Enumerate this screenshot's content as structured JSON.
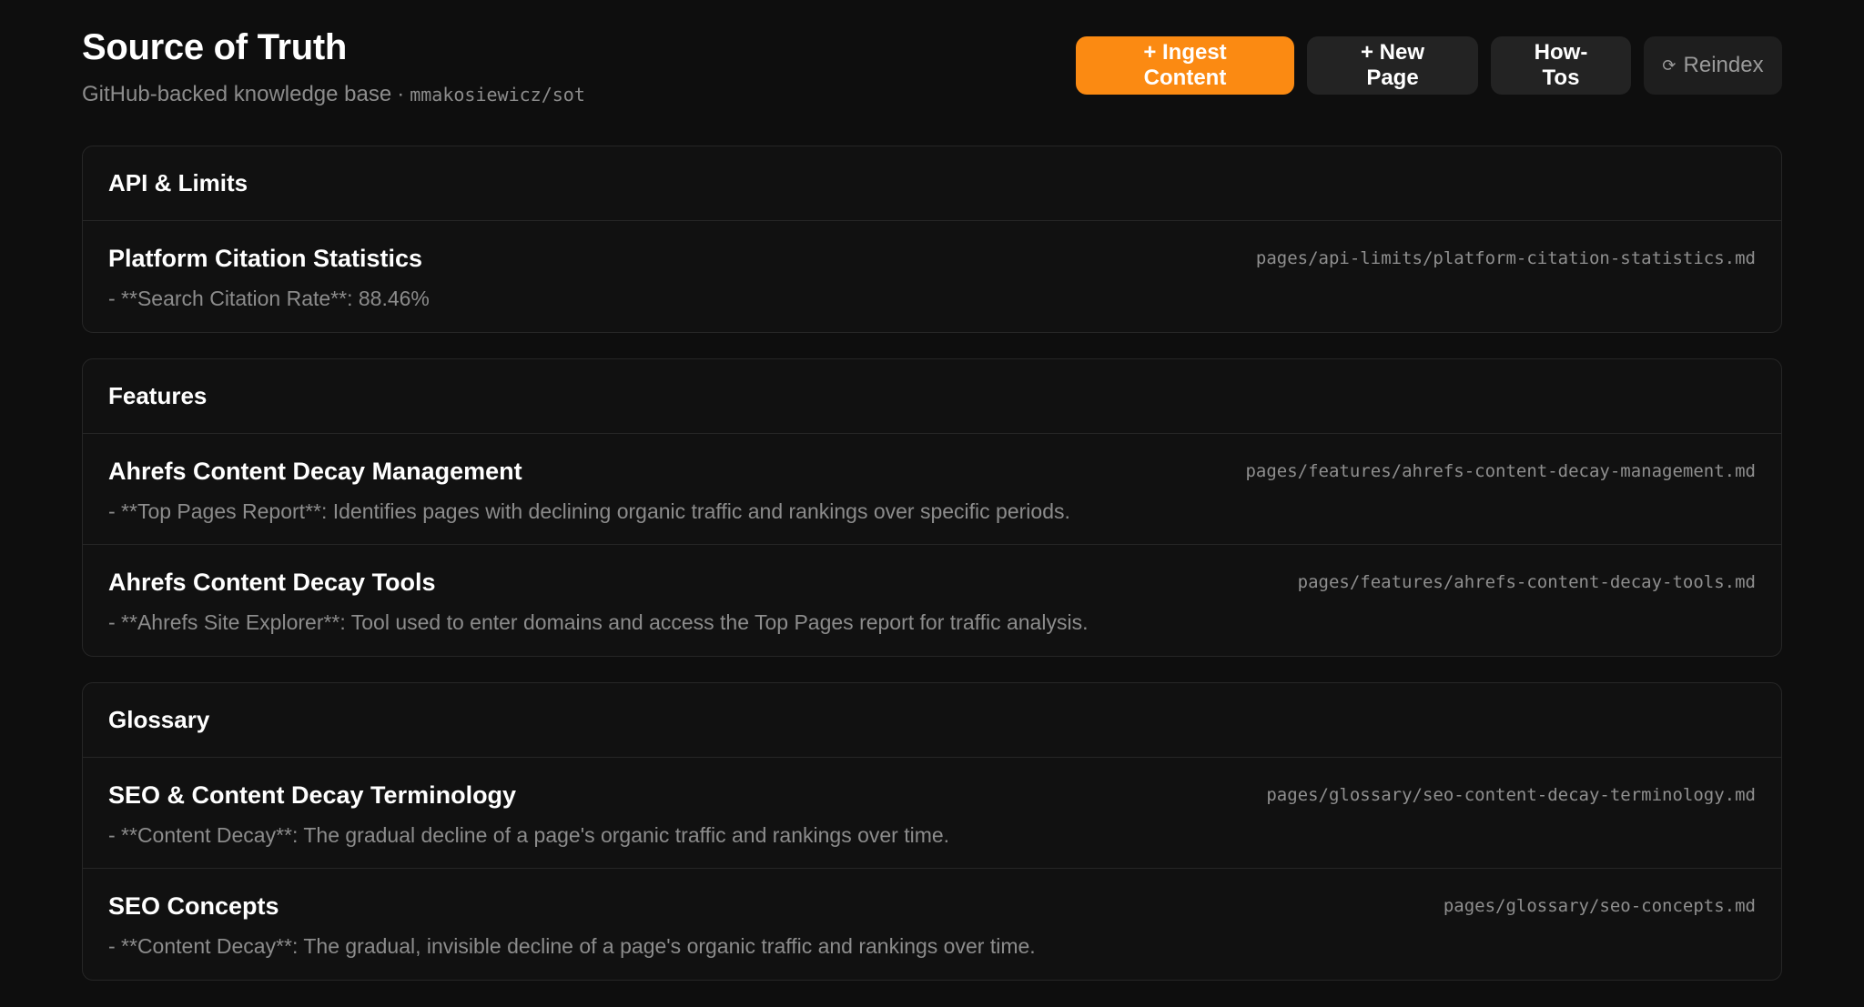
{
  "header": {
    "title": "Source of Truth",
    "subtitle": "GitHub-backed knowledge base",
    "separator": "·",
    "repo": "mmakosiewicz/sot"
  },
  "actions": {
    "ingest_label": "+ Ingest Content",
    "new_page_label": "+ New Page",
    "howtos_label": "How-Tos",
    "reindex_icon": "⟳",
    "reindex_label": "Reindex"
  },
  "colors": {
    "accent": "#fb8a12",
    "background": "#0e0e0e"
  },
  "sections": [
    {
      "name": "API & Limits",
      "entries": [
        {
          "title": "Platform Citation Statistics",
          "path": "pages/api-limits/platform-citation-statistics.md",
          "desc": "- **Search Citation Rate**: 88.46%"
        }
      ]
    },
    {
      "name": "Features",
      "entries": [
        {
          "title": "Ahrefs Content Decay Management",
          "path": "pages/features/ahrefs-content-decay-management.md",
          "desc": "- **Top Pages Report**: Identifies pages with declining organic traffic and rankings over specific periods."
        },
        {
          "title": "Ahrefs Content Decay Tools",
          "path": "pages/features/ahrefs-content-decay-tools.md",
          "desc": "- **Ahrefs Site Explorer**: Tool used to enter domains and access the Top Pages report for traffic analysis."
        }
      ]
    },
    {
      "name": "Glossary",
      "entries": [
        {
          "title": "SEO & Content Decay Terminology",
          "path": "pages/glossary/seo-content-decay-terminology.md",
          "desc": "- **Content Decay**: The gradual decline of a page's organic traffic and rankings over time."
        },
        {
          "title": "SEO Concepts",
          "path": "pages/glossary/seo-concepts.md",
          "desc": "- **Content Decay**: The gradual, invisible decline of a page's organic traffic and rankings over time."
        }
      ]
    }
  ]
}
